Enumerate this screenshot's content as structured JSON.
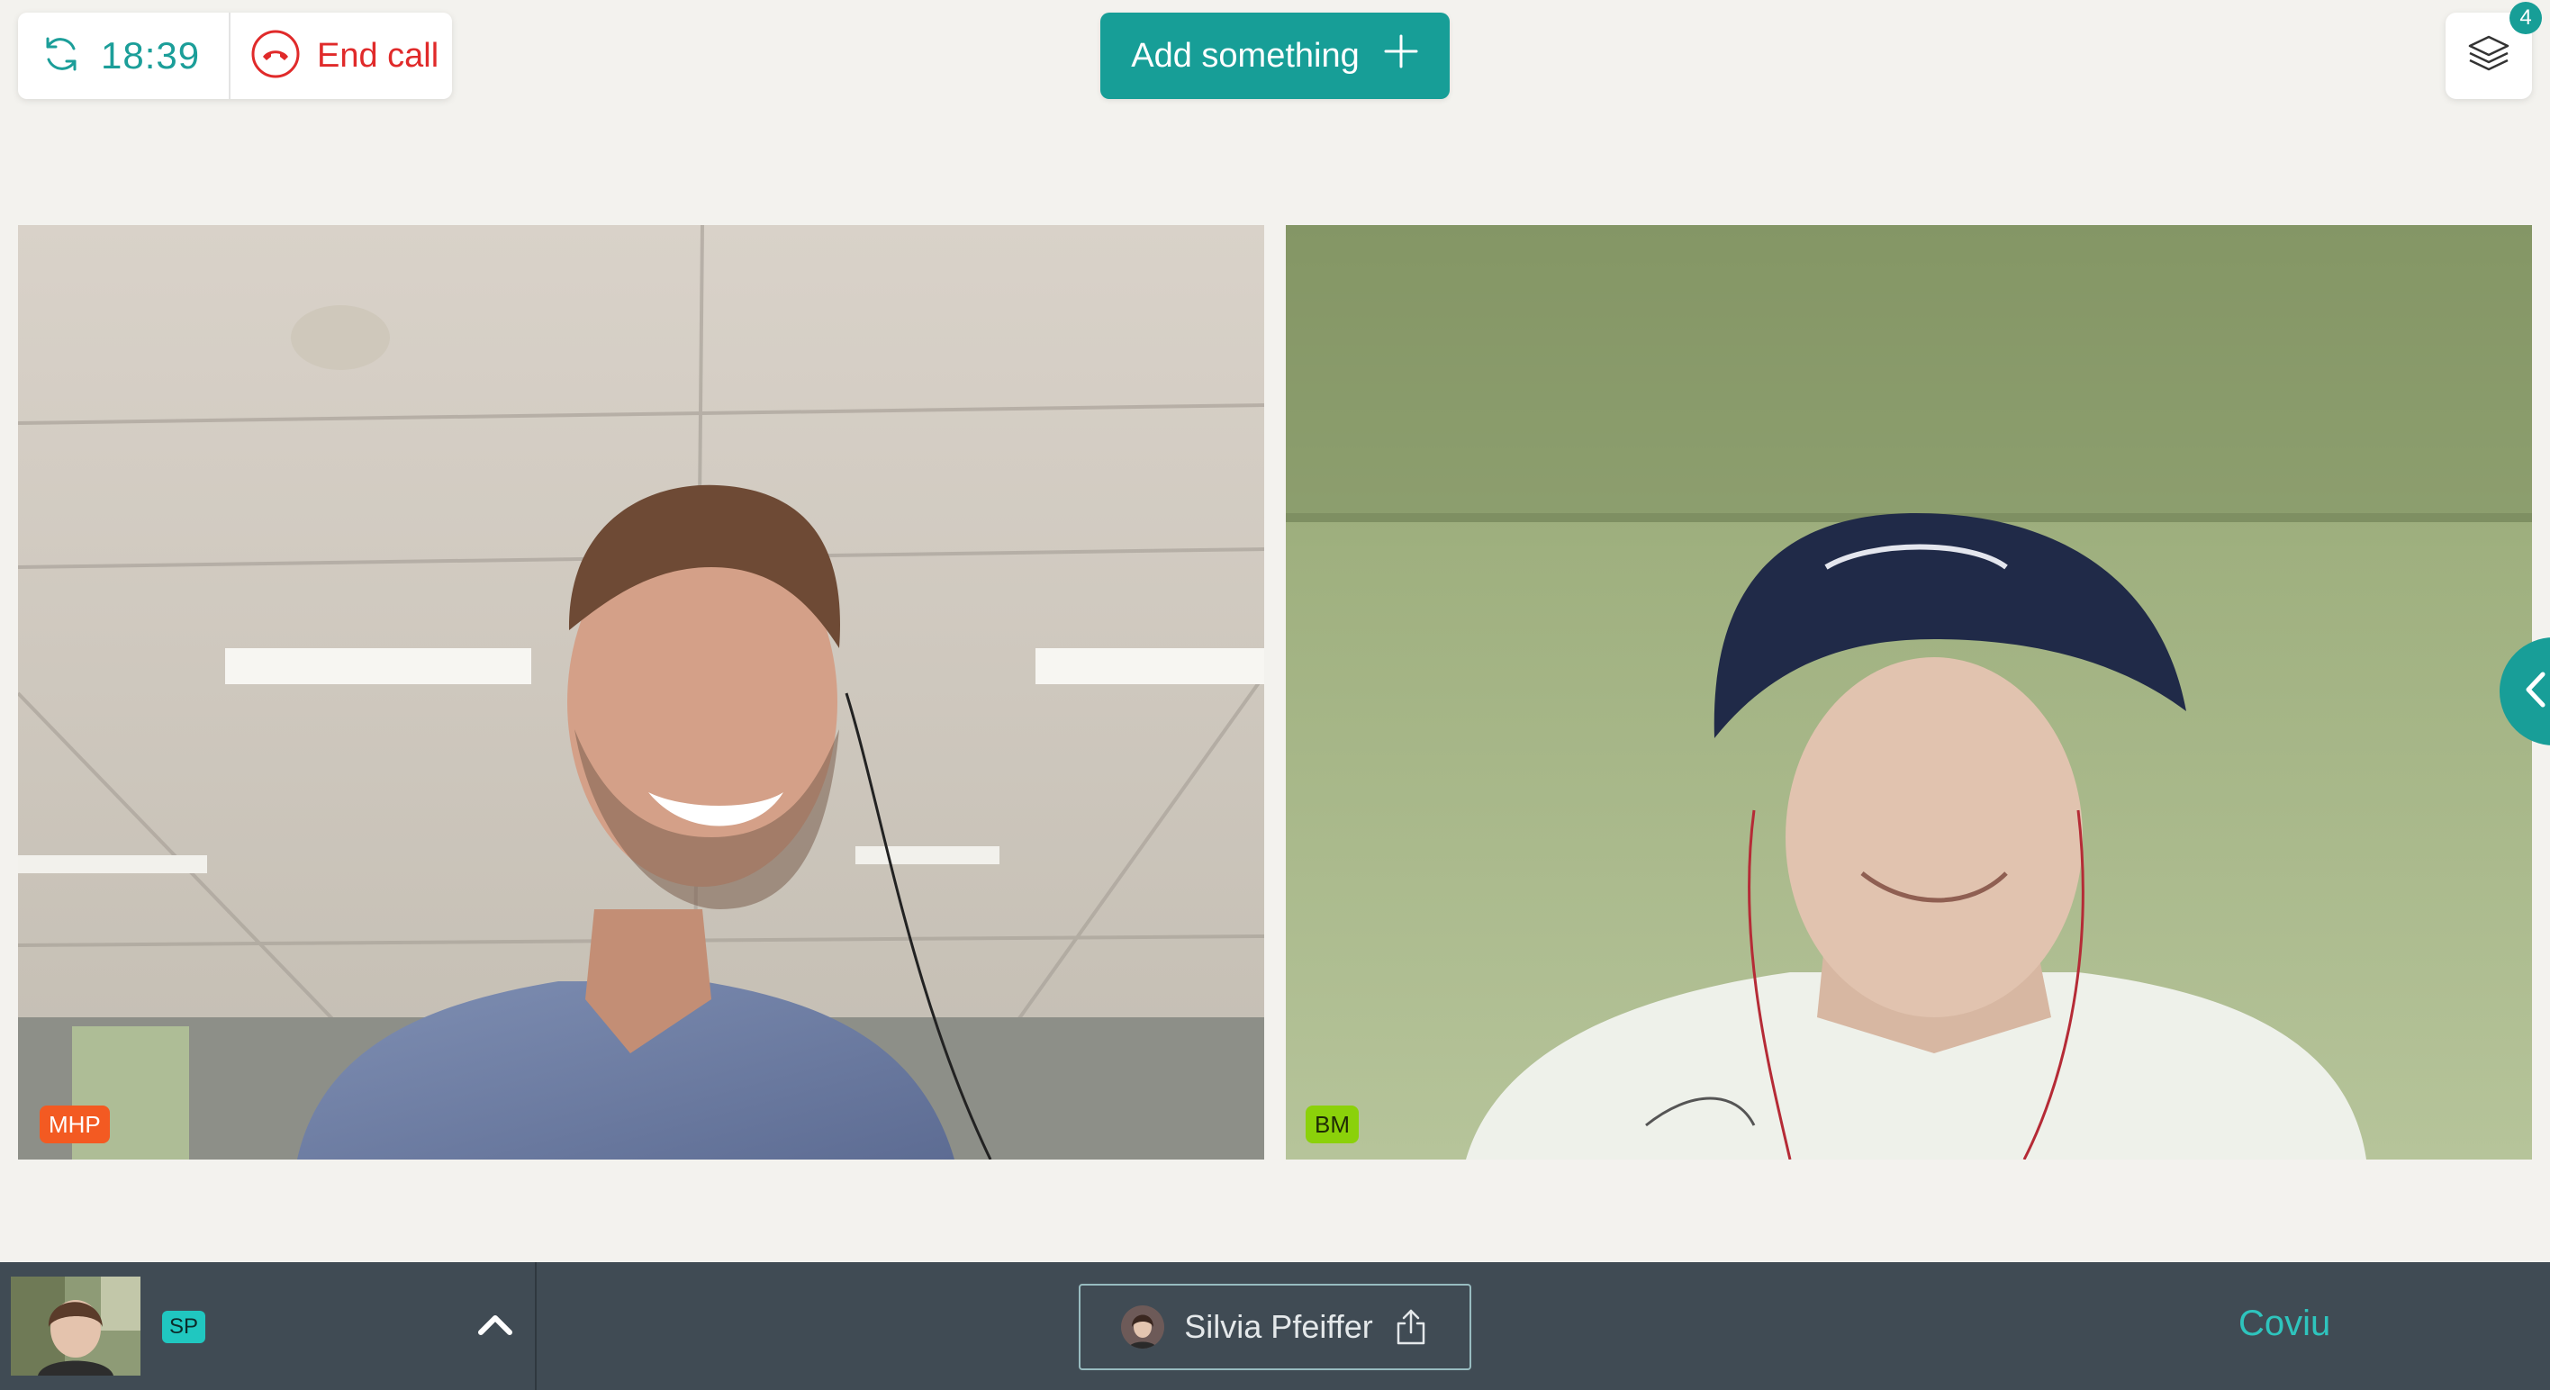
{
  "call": {
    "timer_icon": "refresh-icon",
    "elapsed": "18:39",
    "end_icon": "phone-hangup-icon",
    "end_label": "End call"
  },
  "toolbar": {
    "add_label": "Add something",
    "add_icon": "plus-icon",
    "layers_icon": "layers-icon",
    "layers_count": "4"
  },
  "tiles": [
    {
      "initials": "MHP",
      "badge_color": "#f35a22"
    },
    {
      "initials": "BM",
      "badge_color": "#8bd10a"
    }
  ],
  "side_panel": {
    "icon": "chevron-left-icon"
  },
  "bottom_bar": {
    "self_initials": "SP",
    "collapse_icon": "chevron-up-icon",
    "participant_name": "Silvia Pfeiffer",
    "share_icon": "share-icon",
    "brand": "Coviu"
  },
  "colors": {
    "accent": "#179e97",
    "end_call": "#e02a2a",
    "bottom_bar": "#404b54",
    "background": "#f3f2ee"
  }
}
